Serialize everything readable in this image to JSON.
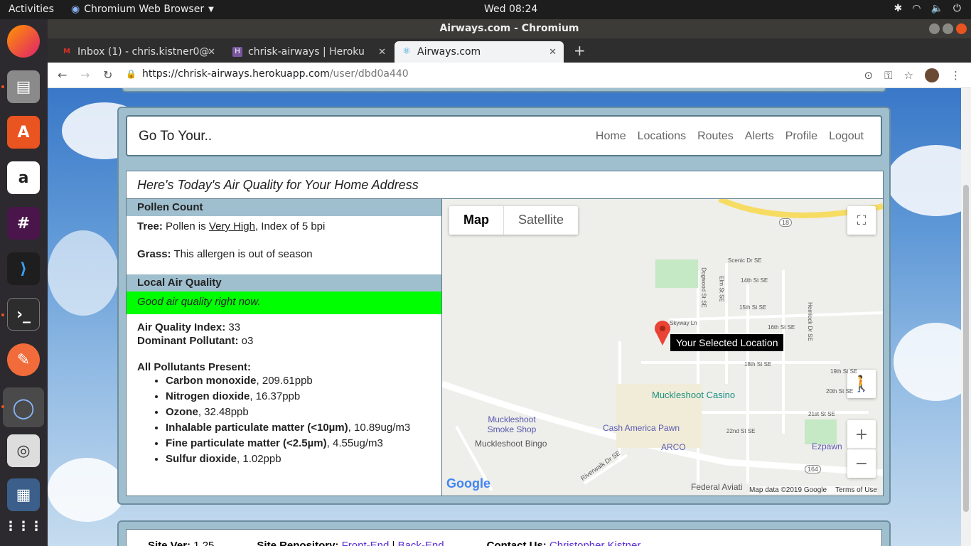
{
  "system": {
    "activities": "Activities",
    "app_menu": "Chromium Web Browser",
    "clock": "Wed 08:24"
  },
  "window": {
    "title": "Airways.com - Chromium"
  },
  "tabs": [
    {
      "label": "Inbox (1) - chris.kistner0@"
    },
    {
      "label": "chrisk-airways | Heroku"
    },
    {
      "label": "Airways.com"
    }
  ],
  "address": {
    "host": "https://chrisk-airways.herokuapp.com",
    "path": "/user/dbd0a440"
  },
  "nav": {
    "brand": "Go To Your..",
    "links": [
      "Home",
      "Locations",
      "Routes",
      "Alerts",
      "Profile",
      "Logout"
    ]
  },
  "heading": "Here's Today's Air Quality for Your Home Address",
  "pollen": {
    "title": "Pollen Count",
    "tree_label": "Tree:",
    "tree_prefix": "Pollen is",
    "tree_level": "Very High",
    "tree_suffix": ", Index of 5 bpi",
    "grass_label": "Grass:",
    "grass_text": "This allergen is out of season"
  },
  "air": {
    "title": "Local Air Quality",
    "status": "Good air quality right now.",
    "status_color": "#00ff00",
    "aqi_label": "Air Quality Index:",
    "aqi_value": "33",
    "dominant_label": "Dominant Pollutant:",
    "dominant_value": "o3",
    "pollutants_title": "All Pollutants Present:",
    "pollutants": [
      {
        "name": "Carbon monoxide",
        "value": ", 209.61ppb"
      },
      {
        "name": "Nitrogen dioxide",
        "value": ", 16.37ppb"
      },
      {
        "name": "Ozone",
        "value": ", 32.48ppb"
      },
      {
        "name": "Inhalable particulate matter (<10µm)",
        "value": ", 10.89ug/m3"
      },
      {
        "name": "Fine particulate matter (<2.5µm)",
        "value": ", 4.55ug/m3"
      },
      {
        "name": "Sulfur dioxide",
        "value": ", 1.02ppb"
      }
    ]
  },
  "map": {
    "type_map": "Map",
    "type_satellite": "Satellite",
    "tooltip": "Your Selected Location",
    "places": [
      "Muckleshoot Casino",
      "Muckleshoot Smoke Shop",
      "Muckleshoot Bingo",
      "Cash America Pawn",
      "ARCO",
      "Ezpawn",
      "Federal Aviati"
    ],
    "streets": [
      "Scenic Dr SE",
      "14th St SE",
      "15th St SE",
      "16th St SE",
      "18th St SE",
      "19th St SE",
      "20th St SE",
      "21st St SE",
      "22nd St SE",
      "Riverwalk Dr SE",
      "Skyway Ln",
      "Dogwood St SE",
      "Elm St SE",
      "Hemlock Dr SE"
    ],
    "route_18": "18",
    "route_164": "164",
    "google": "Google",
    "attribution": "Map data ©2019 Google",
    "terms": "Terms of Use"
  },
  "footer": {
    "version_label": "Site Ver:",
    "version": "1.25",
    "repo_label": "Site Repository:",
    "frontend": "Front-End",
    "sep": "|",
    "backend": "Back-End",
    "contact_label": "Contact Us:",
    "contact": "Christopher Kistner"
  }
}
